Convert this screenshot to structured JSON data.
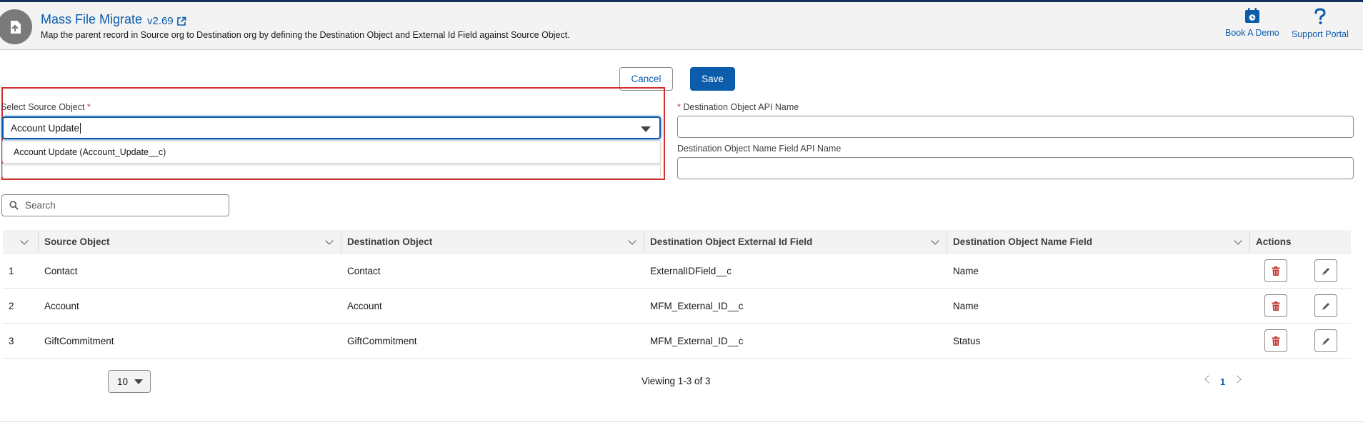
{
  "header": {
    "title": "Mass File Migrate",
    "version": "v2.69",
    "description": "Map the parent record in Source org to Destination org by defining the Destination Object and External Id Field against Source Object.",
    "book_demo": "Book A Demo",
    "support_portal": "Support Portal"
  },
  "actions": {
    "cancel": "Cancel",
    "save": "Save"
  },
  "form": {
    "source_label": "Select Source Object",
    "required_mark": "*",
    "source_value": "Account Update",
    "dropdown_option": "Account Update (Account_Update__c)",
    "dest_api_label": "Destination Object API Name",
    "dest_name_label": "Destination Object Name Field API Name"
  },
  "search": {
    "placeholder": "Search"
  },
  "table": {
    "columns": [
      "Source Object",
      "Destination Object",
      "Destination Object External Id Field",
      "Destination Object Name Field",
      "Actions"
    ],
    "rows": [
      {
        "num": "1",
        "source": "Contact",
        "destination": "Contact",
        "external_id": "ExternalIDField__c",
        "name_field": "Name"
      },
      {
        "num": "2",
        "source": "Account",
        "destination": "Account",
        "external_id": "MFM_External_ID__c",
        "name_field": "Name"
      },
      {
        "num": "3",
        "source": "GiftCommitment",
        "destination": "GiftCommitment",
        "external_id": "MFM_External_ID__c",
        "name_field": "Status"
      }
    ]
  },
  "footer": {
    "page_size": "10",
    "viewing": "Viewing 1-3 of 3",
    "current_page": "1"
  },
  "colors": {
    "brand": "#0b5cab",
    "delete": "#c23934",
    "highlight_box": "#d32f2f"
  },
  "icons": [
    "app-logo-icon",
    "external-link-icon",
    "calendar-icon",
    "help-icon",
    "search-icon",
    "chevron-down-icon",
    "trash-icon",
    "pencil-icon",
    "chevron-left-icon",
    "chevron-right-icon"
  ]
}
